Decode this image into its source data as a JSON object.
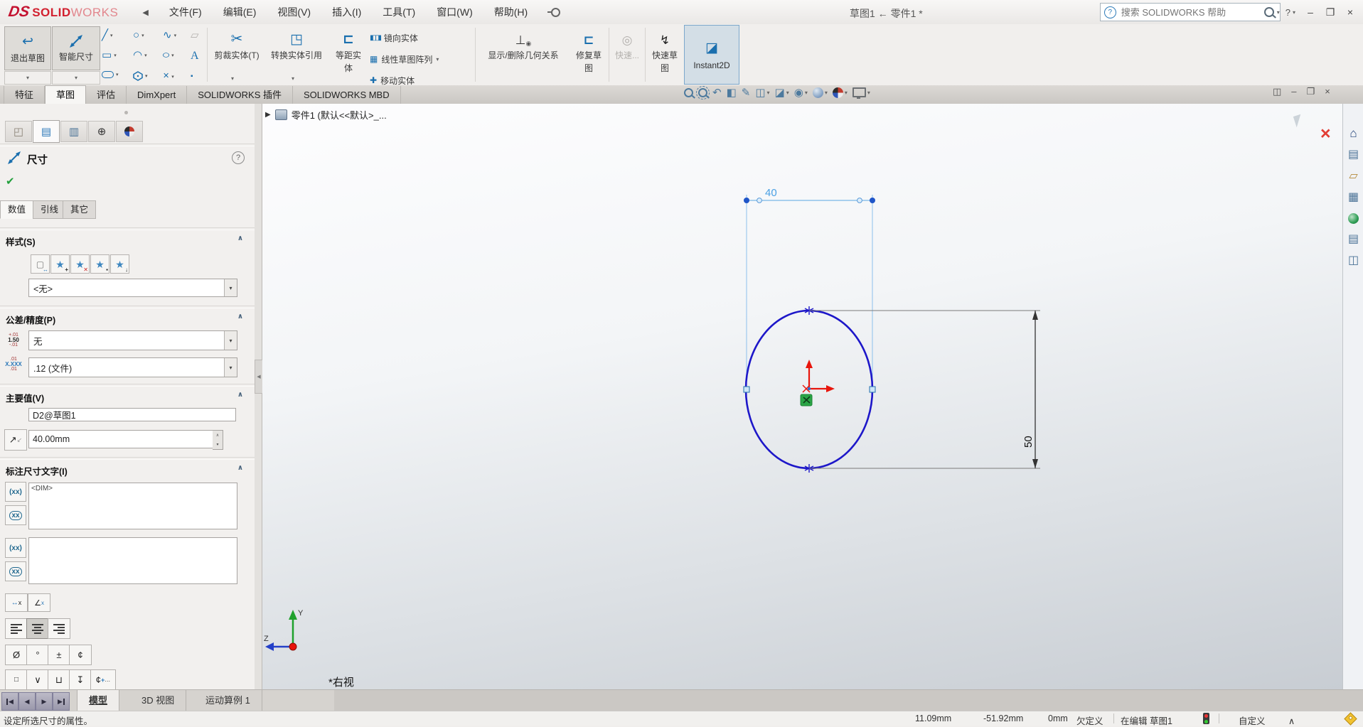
{
  "titlebar": {
    "logo_mark": "DS",
    "logo_solid": "SOLID",
    "logo_works": "WORKS",
    "menus": [
      {
        "label": "文件(F)"
      },
      {
        "label": "编辑(E)"
      },
      {
        "label": "视图(V)"
      },
      {
        "label": "插入(I)"
      },
      {
        "label": "工具(T)"
      },
      {
        "label": "窗口(W)"
      },
      {
        "label": "帮助(H)"
      }
    ],
    "doc_title": "草图1 ← 零件1 *",
    "search_placeholder": "搜索 SOLIDWORKS 帮助",
    "help_label": "?"
  },
  "ribbon": {
    "exit_sketch": "退出草图",
    "smart_dimension": "智能尺寸",
    "trim_entities": "剪裁实体(T)",
    "convert_entities": "转换实体引用",
    "offset_entities_1": "等距实",
    "offset_entities_2": "体",
    "mirror_entities": "镜向实体",
    "linear_sketch_pattern": "线性草图阵列",
    "move_entities": "移动实体",
    "display_delete_relations": "显示/删除几何关系",
    "repair_sketch_1": "修复草",
    "repair_sketch_2": "图",
    "rapid_dimension": "快速...",
    "rapid_sketch_1": "快速草",
    "rapid_sketch_2": "图",
    "instant2d": "Instant2D"
  },
  "command_tabs": {
    "items": [
      {
        "label": "特征"
      },
      {
        "label": "草图"
      },
      {
        "label": "评估"
      },
      {
        "label": "DimXpert"
      },
      {
        "label": "SOLIDWORKS 插件"
      },
      {
        "label": "SOLIDWORKS MBD"
      }
    ]
  },
  "panel": {
    "title": "尺寸",
    "tab_value": "数值",
    "tab_leader": "引线",
    "tab_other": "其它",
    "style_header": "样式(S)",
    "style_value": "<无>",
    "tol_header": "公差/精度(P)",
    "tol_value": "无",
    "tol_icon": {
      "top": "+.01",
      "mid": "1.50",
      "bot": "-.01"
    },
    "prec_value": ".12 (文件)",
    "prec_icon": {
      "top": ".01",
      "mid": "X.XXX",
      "bot": ".01"
    },
    "primary_header": "主要值(V)",
    "dim_name": "D2@草图1",
    "dim_value": "40.00mm",
    "dimtext_header": "标注尺寸文字(I)",
    "dimtext_value": "<DIM>"
  },
  "viewport": {
    "tree_label": "零件1 (默认<<默认>_...",
    "view_label": "*右视",
    "dim_width": "40",
    "dim_height": "50",
    "axis_y": "Y",
    "axis_z": "Z"
  },
  "model_tabs": {
    "items": [
      {
        "label": "模型"
      },
      {
        "label": "3D 视图"
      },
      {
        "label": "运动算例 1"
      }
    ]
  },
  "status": {
    "hint": "设定所选尺寸的属性。",
    "x": "11.09mm",
    "y": "-51.92mm",
    "z": "0mm",
    "state": "欠定义",
    "editing": "在编辑 草图1",
    "units": "自定义"
  },
  "colors": {
    "sketch_blue": "#1d17c9",
    "dim_selected": "#58a8e8",
    "origin_red": "#e8150c",
    "relation_green": "#2aa546",
    "logo_red": "#d2202f"
  },
  "glyphs": {
    "caret": "▾",
    "collapse": "∧",
    "back": "◀",
    "fwd": "▶",
    "check": "✔",
    "close": "×",
    "minimize": "–",
    "restore": "❐",
    "pane": "◫",
    "line": "╱",
    "circle": "○",
    "spline": "∿",
    "plane": "▱",
    "rect": "▭",
    "arc": "◠",
    "ellipse": "○",
    "text_tool": "A",
    "trim_small": "✕",
    "point": "▪",
    "scissors": "✂",
    "cube": "◳",
    "offset": "⊏",
    "mirror": "◧◨",
    "pattern": "▦",
    "move": "✚",
    "perp": "⊥",
    "eye": "◉",
    "rapid": "◎",
    "lightning": "↯",
    "instant": "◪",
    "exit": "↩",
    "pencil": "✎",
    "star": "★",
    "plus": "+",
    "diameter": "Ø",
    "degree": "°",
    "plusminus": "±",
    "centerline": "¢",
    "square": "□",
    "vee": "∨",
    "cup": "⊔",
    "downbar": "↧",
    "xx_paren": "(xx)",
    "xx_plain": "xx",
    "arrow_ne": "↗",
    "arrow_sw": "↙",
    "home": "⌂",
    "library": "▤",
    "folder": "▱",
    "palette": "▦",
    "props": "▤",
    "forum": "◫",
    "prev_view": "↶",
    "section": "◧",
    "annot": "✎",
    "view_cube": "◫",
    "disp_style": "◪",
    "dots": "…",
    "tree_expand": "▶",
    "q": "?"
  }
}
